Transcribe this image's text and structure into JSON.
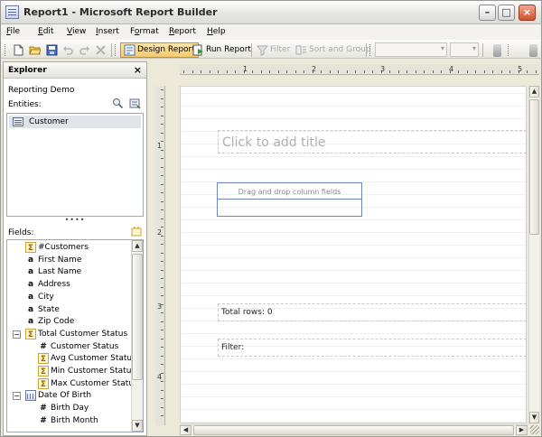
{
  "window": {
    "title": "Report1 - Microsoft Report Builder"
  },
  "menu": [
    {
      "label": "File",
      "key": "F"
    },
    {
      "label": "Edit",
      "key": "E"
    },
    {
      "label": "View",
      "key": "V"
    },
    {
      "label": "Insert",
      "key": "I"
    },
    {
      "label": "Format",
      "key": "o"
    },
    {
      "label": "Report",
      "key": "R"
    },
    {
      "label": "Help",
      "key": "H"
    }
  ],
  "toolbar": {
    "design_report": "Design Report",
    "run_report": "Run Report",
    "filter": "Filter",
    "sort_and_group": "Sort and Group"
  },
  "explorer": {
    "title": "Explorer",
    "close": "×",
    "model_name": "Reporting Demo",
    "entities_label": "Entities:",
    "entities": [
      "Customer"
    ],
    "splitter": "••••",
    "fields_label": "Fields:",
    "fields": [
      {
        "label": "#Customers",
        "type": "aggregate"
      },
      {
        "label": "First Name",
        "type": "text"
      },
      {
        "label": "Last Name",
        "type": "text"
      },
      {
        "label": "Address",
        "type": "text"
      },
      {
        "label": "City",
        "type": "text"
      },
      {
        "label": "State",
        "type": "text"
      },
      {
        "label": "Zip Code",
        "type": "text"
      },
      {
        "label": "Total Customer Status",
        "type": "aggregate",
        "expander": "−"
      },
      {
        "label": "Customer Status",
        "type": "number"
      },
      {
        "label": "Avg Customer Status",
        "type": "aggregate"
      },
      {
        "label": "Min Customer Status",
        "type": "aggregate"
      },
      {
        "label": "Max Customer Status",
        "type": "aggregate"
      },
      {
        "label": "Date Of Birth",
        "type": "date",
        "expander": "−"
      },
      {
        "label": "Birth Day",
        "type": "number"
      },
      {
        "label": "Birth Month",
        "type": "number"
      }
    ]
  },
  "ruler": {
    "h": [
      "1",
      "2",
      "3",
      "4",
      "5"
    ],
    "v": [
      "1",
      "2",
      "3",
      "4"
    ]
  },
  "report": {
    "title_placeholder": "Click to add title",
    "table_header": "Drag and drop column fields",
    "total_rows": "Total rows: 0",
    "filter": "Filter:"
  },
  "icons": {
    "text_glyph": "a",
    "number_glyph": "#",
    "aggregate_glyph": "Σ"
  }
}
